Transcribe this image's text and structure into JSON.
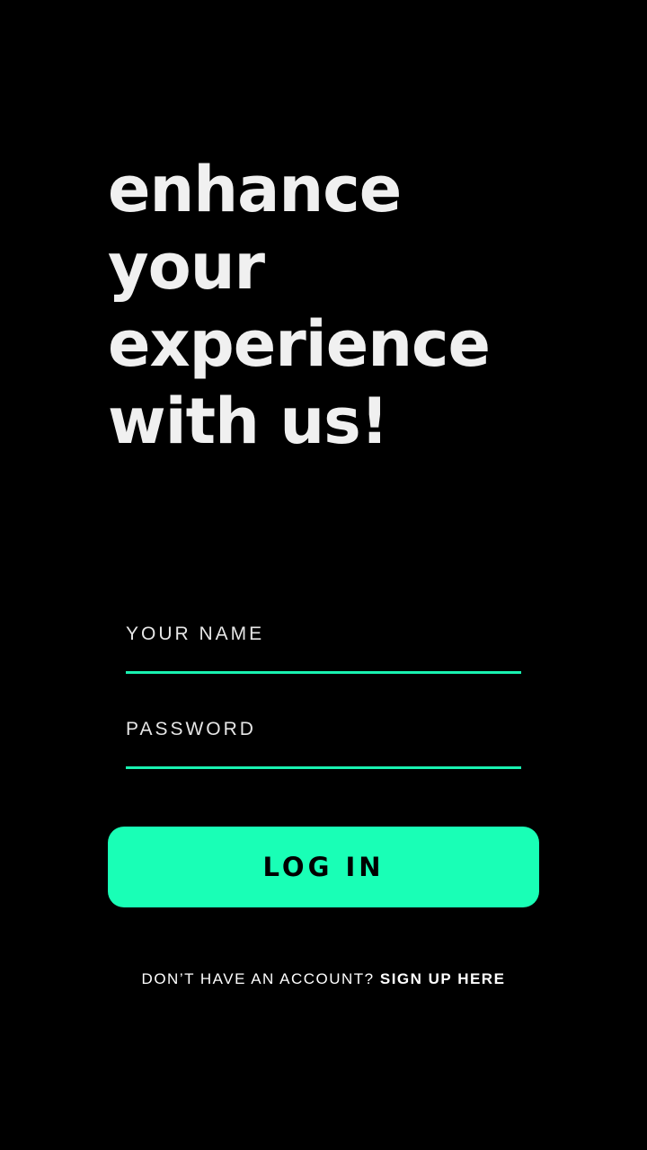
{
  "headline": {
    "lines": [
      "enhance",
      "your",
      "experience",
      "with us!"
    ]
  },
  "form": {
    "name_placeholder": "YOUR NAME",
    "password_placeholder": "PASSWORD",
    "login_label": "LOG IN"
  },
  "signup": {
    "prompt": "DON’T HAVE AN ACCOUNT?",
    "link_label": "SIGN UP HERE"
  },
  "colors": {
    "background": "#000000",
    "accent": "#19ffb6",
    "underline": "#19f2b1",
    "text": "#f0f0f0"
  }
}
